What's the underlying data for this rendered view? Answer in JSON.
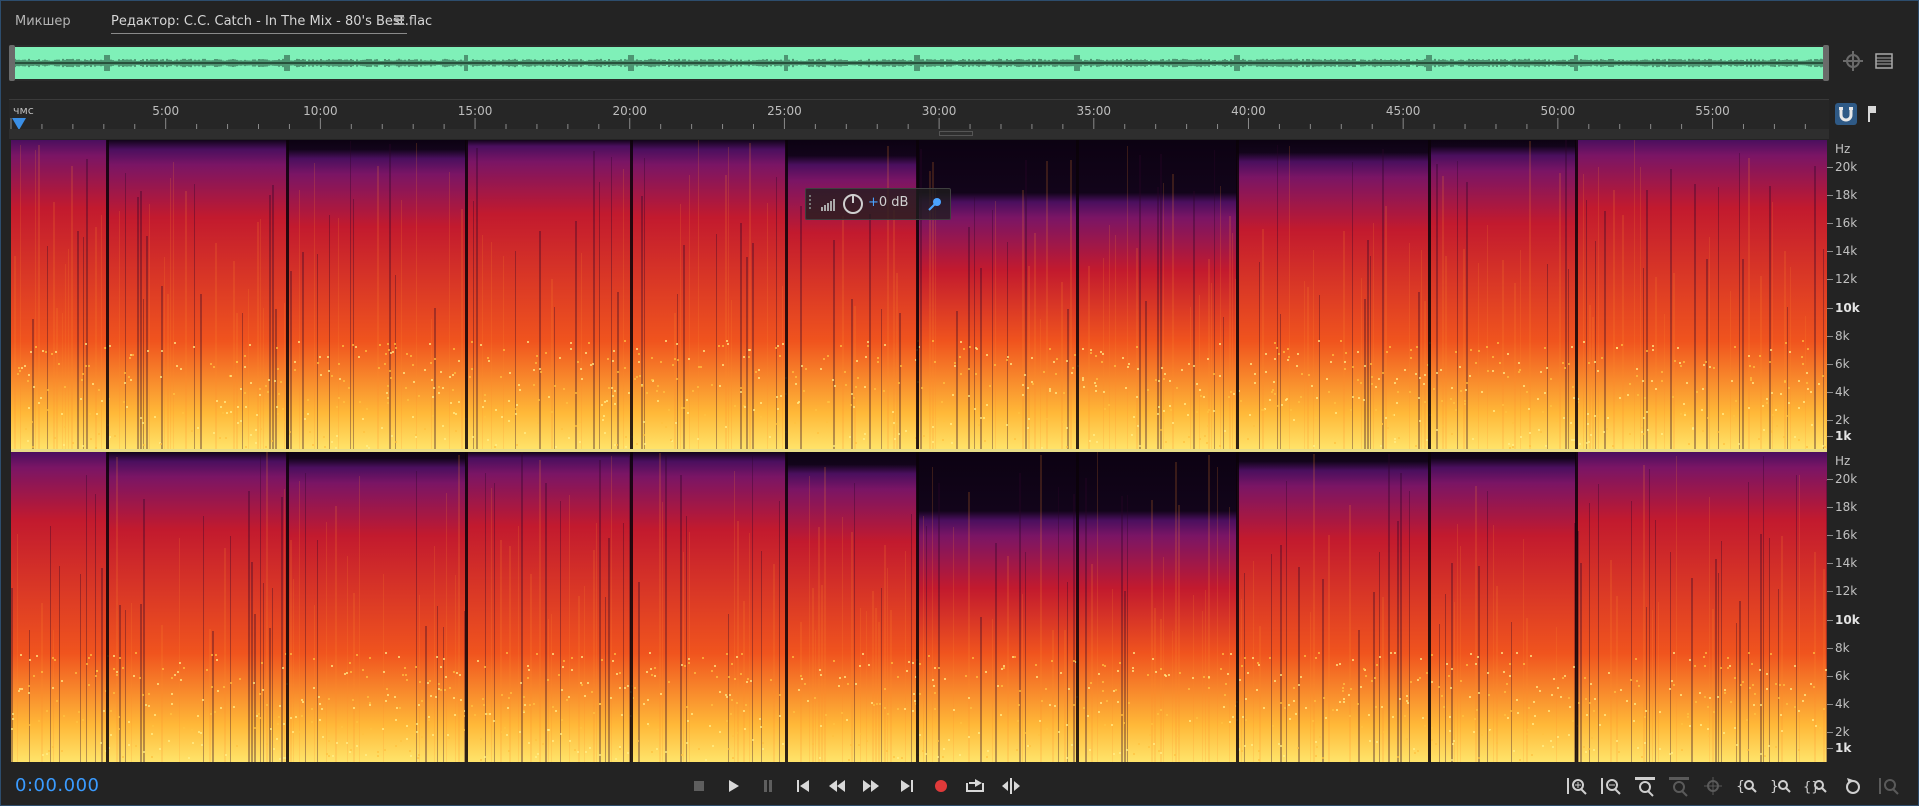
{
  "tabs": {
    "mixer_label": "Микшер",
    "editor_label": "Редактор: C.C. Catch - In The Mix - 80's Best.flac"
  },
  "ruler": {
    "unit": "чмс",
    "labels": [
      "5:00",
      "10:00",
      "15:00",
      "20:00",
      "25:00",
      "30:00",
      "35:00",
      "40:00",
      "45:00",
      "50:00",
      "55:00"
    ]
  },
  "frequency_axis": {
    "unit": "Hz",
    "labels": [
      "20k",
      "18k",
      "16k",
      "14k",
      "12k",
      "10k",
      "8k",
      "6k",
      "4k",
      "2k",
      "1k"
    ]
  },
  "hud": {
    "gain_sign": "+",
    "gain_value": "0 dB"
  },
  "transport": {
    "current_time": "0:00.000"
  },
  "colors": {
    "overview_waveform_bg": "#7ff0b8",
    "accent_blue": "#3a9bff",
    "record_red": "#e03a3a",
    "spectrogram_low": "#ffd14a",
    "spectrogram_mid": "#e0301e",
    "spectrogram_high": "#5a1570"
  },
  "icons": {
    "tab_menu": "hamburger-icon",
    "zoom_overview": "zoom-crosshair-icon",
    "overview_menu": "panel-menu-icon",
    "snap": "magnet-icon",
    "marker": "marker-flag-icon",
    "hud_level": "level-meter-icon",
    "hud_knob": "gain-knob-icon",
    "hud_pin": "pin-icon"
  }
}
